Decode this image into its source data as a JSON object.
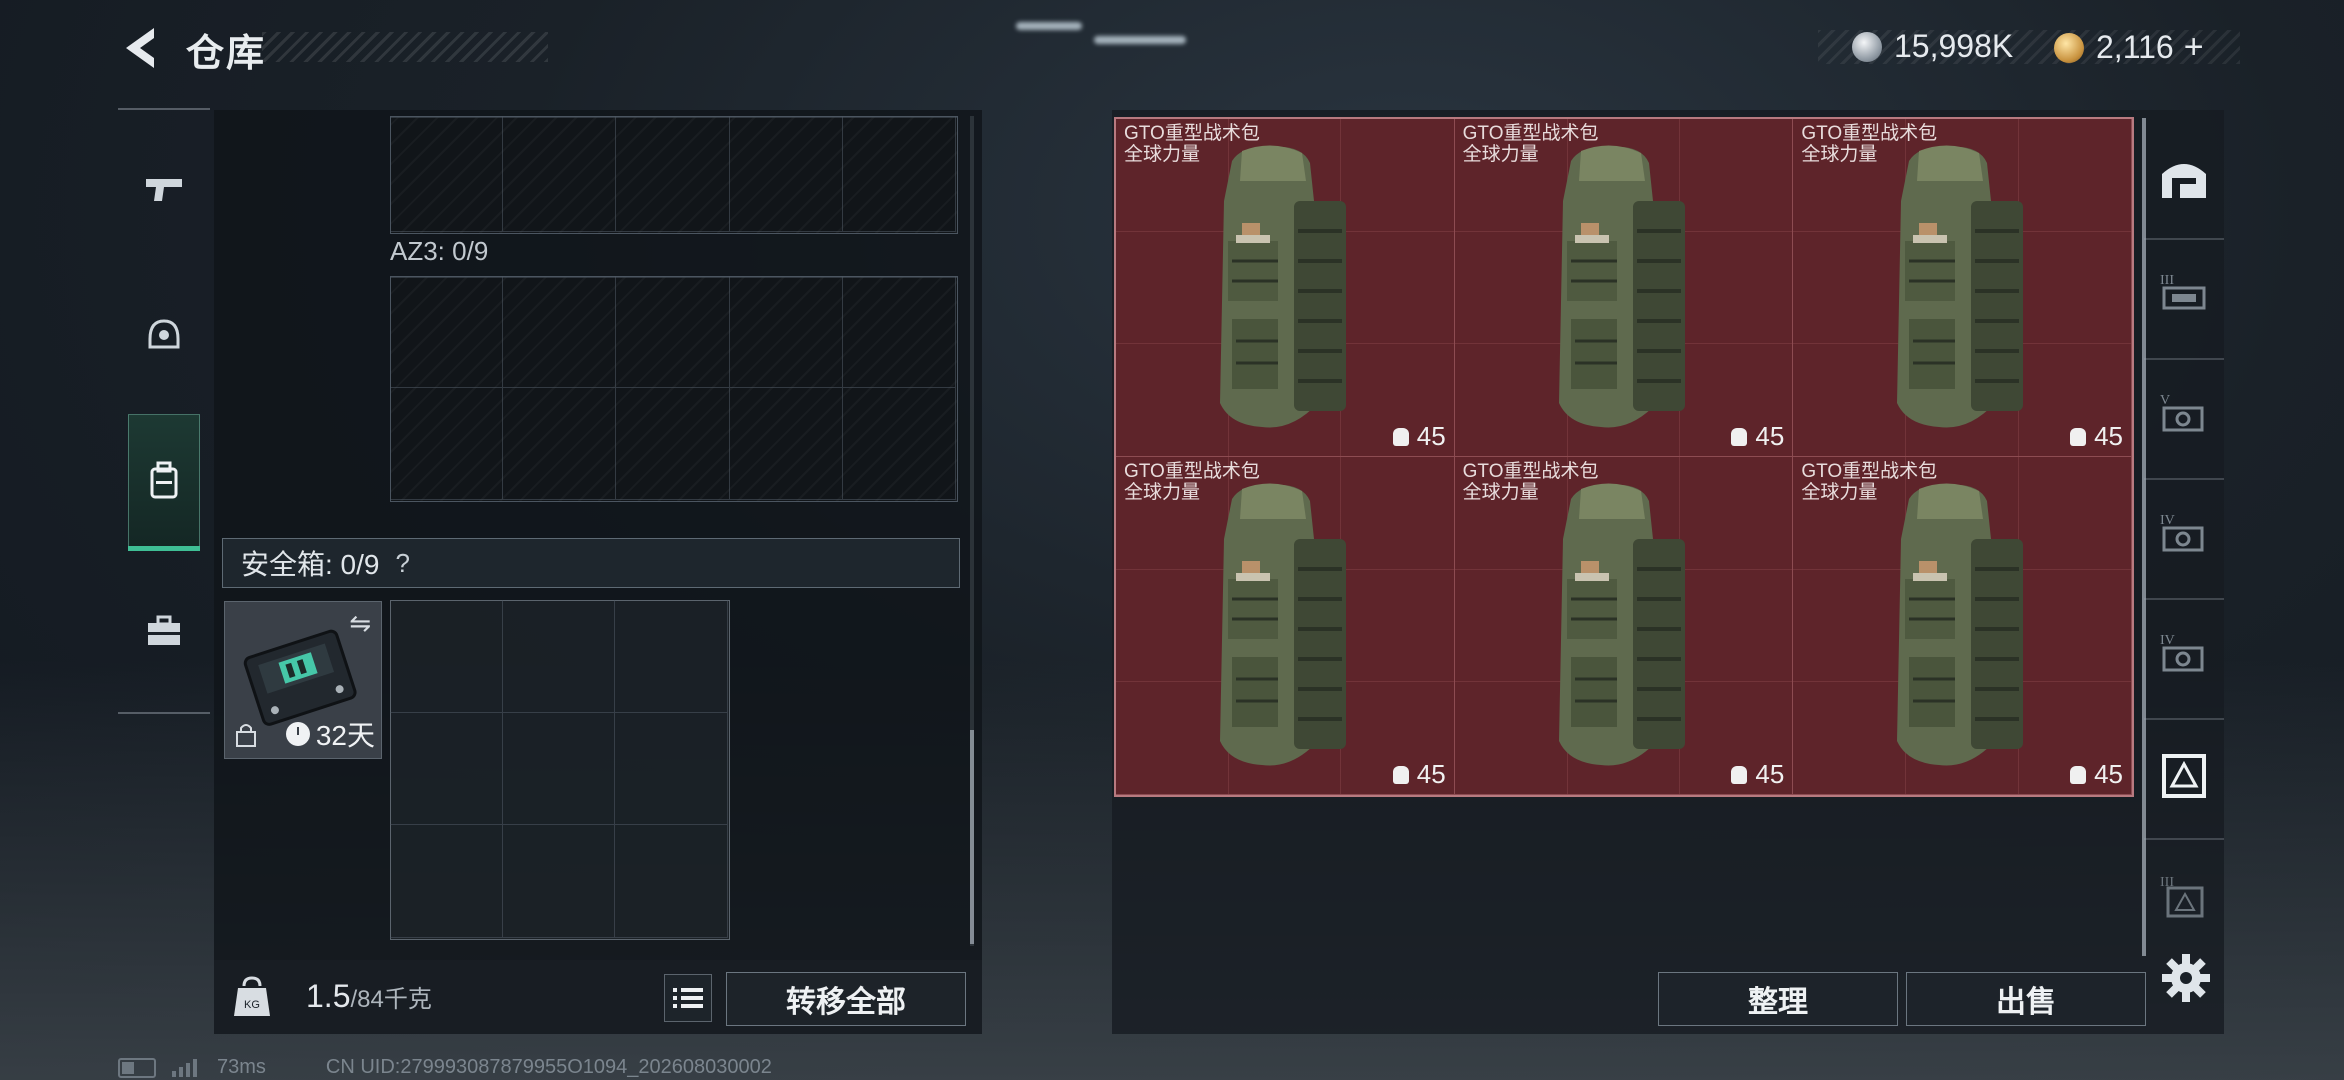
{
  "header": {
    "title": "仓库"
  },
  "currency": {
    "silver": {
      "value": "15,998K",
      "icon": "silver-coin-icon"
    },
    "gold": {
      "value": "2,116",
      "icon": "gold-coin-icon"
    },
    "add_label": "+"
  },
  "left_nav": {
    "items": [
      {
        "name": "weapons",
        "icon": "pistol-icon"
      },
      {
        "name": "equipment",
        "icon": "helmet-icon"
      },
      {
        "name": "backpack",
        "icon": "backpack-icon",
        "active": true
      },
      {
        "name": "supplies",
        "icon": "toolbox-icon"
      }
    ]
  },
  "storage": {
    "az3_label": "AZ3: 0/9",
    "safe_label": "安全箱: 0/9",
    "safe_help": "?",
    "safe_timer": "32天",
    "weight_value": "1.5",
    "weight_max": "/84千克",
    "transfer_all": "转移全部"
  },
  "items": [
    {
      "name": "GTO重型战术包",
      "subtitle": "全球力量",
      "count": "45"
    },
    {
      "name": "GTO重型战术包",
      "subtitle": "全球力量",
      "count": "45"
    },
    {
      "name": "GTO重型战术包",
      "subtitle": "全球力量",
      "count": "45"
    },
    {
      "name": "GTO重型战术包",
      "subtitle": "全球力量",
      "count": "45"
    },
    {
      "name": "GTO重型战术包",
      "subtitle": "全球力量",
      "count": "45"
    },
    {
      "name": "GTO重型战术包",
      "subtitle": "全球力量",
      "count": "45"
    }
  ],
  "actions": {
    "organize": "整理",
    "sell": "出售"
  },
  "right_rail": {
    "items": [
      "safehouse-icon",
      "tier-iii-armor-icon",
      "tier-v-armor-icon",
      "tier-iv-armor-icon",
      "tier-iv-armor-icon",
      "backpack-tier-icon",
      "tier-iii-backpack-icon"
    ]
  },
  "status": {
    "latency": "73ms",
    "uid": "CN UID:279993087879955O1094_202608030002"
  },
  "colors": {
    "accent": "#3fbf95",
    "item_bg": "#5e242a"
  }
}
